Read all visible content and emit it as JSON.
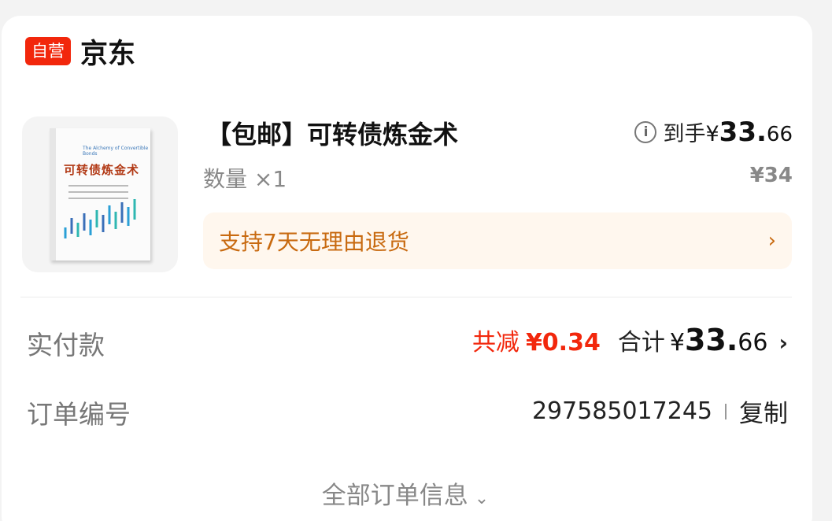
{
  "shop": {
    "badge": "自营",
    "name": "京东"
  },
  "product": {
    "title": "【包邮】可转债炼金术",
    "cover_title": "可转债炼金术",
    "cover_subtitle": "The Alchemy of Convertible Bonds",
    "final_price_label": "到手",
    "final_price_symbol": "¥",
    "final_price_int": "33.",
    "final_price_dec": "66",
    "quantity": "数量 ×1",
    "original_price": "¥34"
  },
  "return_policy": {
    "text": "支持7天无理由退货",
    "chevron": "›"
  },
  "payment": {
    "label": "实付款",
    "discount_label": "共减",
    "discount_value": "¥0.34",
    "total_label": "合计",
    "total_symbol": "¥",
    "total_int": "33.",
    "total_dec": "66",
    "chevron": "›"
  },
  "order": {
    "label": "订单编号",
    "number": "297585017245",
    "copy_label": "复制"
  },
  "more": {
    "label": "全部订单信息",
    "chevron": "⌄"
  },
  "colors": {
    "brand_red": "#f2270c",
    "return_orange": "#c86a10",
    "return_bg": "#fff7ee"
  },
  "icons": {
    "info": "info-icon",
    "chevron": "chevron-right-icon",
    "expand": "chevron-down-icon"
  }
}
